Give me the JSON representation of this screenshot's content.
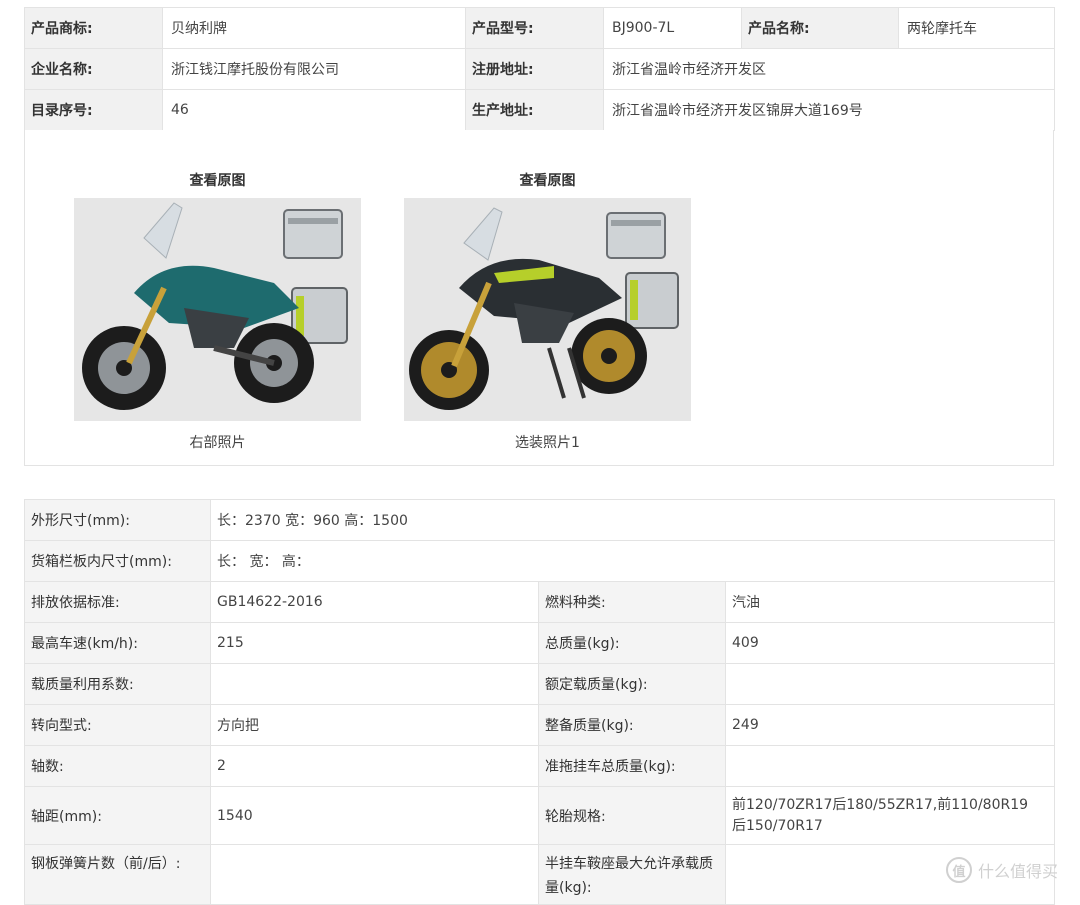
{
  "top_table": {
    "rows": [
      [
        {
          "label": "产品商标:",
          "value": "贝纳利牌"
        },
        {
          "label": "产品型号:",
          "value": "BJ900-7L"
        },
        {
          "label": "产品名称:",
          "value": "两轮摩托车"
        }
      ],
      [
        {
          "label": "企业名称:",
          "value": "浙江钱江摩托股份有限公司"
        },
        {
          "label": "注册地址:",
          "value": "浙江省温岭市经济开发区"
        }
      ],
      [
        {
          "label": "目录序号:",
          "value": "46"
        },
        {
          "label": "生产地址:",
          "value": "浙江省温岭市经济开发区锦屏大道169号"
        }
      ]
    ]
  },
  "photos": [
    {
      "link": "查看原图",
      "caption": "右部照片",
      "body_color": "#1e6b6e"
    },
    {
      "link": "查看原图",
      "caption": "选装照片1",
      "body_color": "#2a2f33"
    }
  ],
  "specs": {
    "dims_label": "外形尺寸(mm):",
    "dims_value": "长：2370 宽：960 高：1500",
    "cargo_label": "货箱栏板内尺寸(mm):",
    "cargo_value": "长： 宽： 高：",
    "rows": [
      {
        "l1": "排放依据标准:",
        "v1": "GB14622-2016",
        "l2": "燃料种类:",
        "v2": "汽油"
      },
      {
        "l1": "最高车速(km/h):",
        "v1": "215",
        "l2": "总质量(kg):",
        "v2": "409"
      },
      {
        "l1": "载质量利用系数:",
        "v1": "",
        "l2": "额定载质量(kg):",
        "v2": ""
      },
      {
        "l1": "转向型式:",
        "v1": "方向把",
        "l2": "整备质量(kg):",
        "v2": "249"
      },
      {
        "l1": "轴数:",
        "v1": "2",
        "l2": "准拖挂车总质量(kg):",
        "v2": ""
      }
    ],
    "wheelbase_label": "轴距(mm):",
    "wheelbase_value": "1540",
    "tire_label": "轮胎规格:",
    "tire_line1": "前120/70ZR17后180/55ZR17,前110/80R19",
    "tire_line2": "后150/70R17",
    "spring_label": "钢板弹簧片数（前/后）:",
    "spring_value": "",
    "saddle_label": "半挂车鞍座最大允许承载质量(kg):",
    "saddle_value": ""
  },
  "watermark": {
    "icon_glyph": "值",
    "text": "什么值得买"
  }
}
